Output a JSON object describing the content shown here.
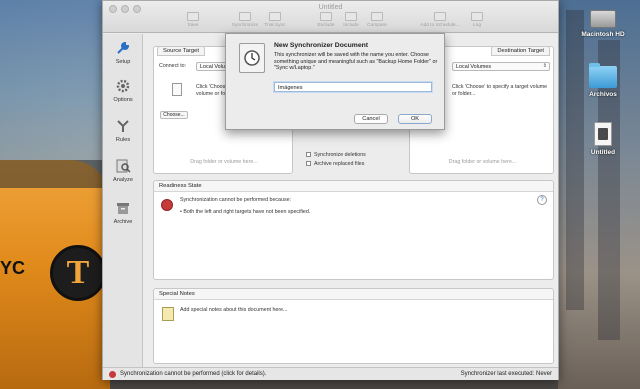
{
  "desktop": {
    "icons": [
      {
        "label": "Macintosh HD",
        "icon": "hard-drive-icon"
      },
      {
        "label": "Archivos",
        "icon": "folder-icon"
      },
      {
        "label": "Untitled",
        "icon": "document-icon"
      }
    ],
    "taxi_text": "YC",
    "taxi_letter": "T"
  },
  "window": {
    "title": "Untitled",
    "toolbar": [
      {
        "label": "Save",
        "icon": "save-icon"
      },
      {
        "label": "Synchronize",
        "icon": "synchronize-icon"
      },
      {
        "label": "Trial Sync",
        "icon": "trial-sync-icon"
      },
      {
        "label": "Exclude",
        "icon": "exclude-icon"
      },
      {
        "label": "Include",
        "icon": "include-icon"
      },
      {
        "label": "Compare",
        "icon": "compare-icon"
      },
      {
        "label": "Add to Schedule...",
        "icon": "schedule-icon"
      },
      {
        "label": "Log",
        "icon": "log-icon"
      }
    ],
    "sidebar": [
      {
        "label": "Setup",
        "icon": "wrench-icon"
      },
      {
        "label": "Options",
        "icon": "gear-icon"
      },
      {
        "label": "Rules",
        "icon": "rules-icon"
      },
      {
        "label": "Analyze",
        "icon": "analyze-icon"
      },
      {
        "label": "Archive",
        "icon": "archive-box-icon"
      }
    ],
    "source": {
      "tab": "Source Target",
      "connect_label": "Connect to:",
      "connect_value": "Local Volumes",
      "hint": "Click 'Choose' to specify a source volume or folder...",
      "choose": "Choose...",
      "drag_hint": "Drag folder or volume here..."
    },
    "destination": {
      "tab": "Destination Target",
      "connect_value": "Local Volumes",
      "hint": "Click 'Choose' to specify a target volume or folder...",
      "drag_hint": "Drag folder or volume here..."
    },
    "options": {
      "sync_deletions": "Synchronize deletions",
      "archive_replaced": "Archive replaced files"
    },
    "readiness": {
      "header": "Readiness State",
      "message": "Synchronization cannot be performed because:",
      "bullet": "Both the left and right targets have not been specified.",
      "help": "?"
    },
    "notes": {
      "header": "Special Notes",
      "placeholder": "Add special notes about this document here..."
    },
    "status": {
      "left": "Synchronization cannot be performed (click for details).",
      "right": "Synchronizer last executed:  Never"
    }
  },
  "sheet": {
    "title": "New Synchronizer Document",
    "description": "This synchronizer will be saved with the name you enter. Choose something unique and meaningful such as \"Backup Home Folder\" or \"Sync w/Laptop.\"",
    "input_value": "Imágenes",
    "cancel": "Cancel",
    "ok": "OK"
  }
}
